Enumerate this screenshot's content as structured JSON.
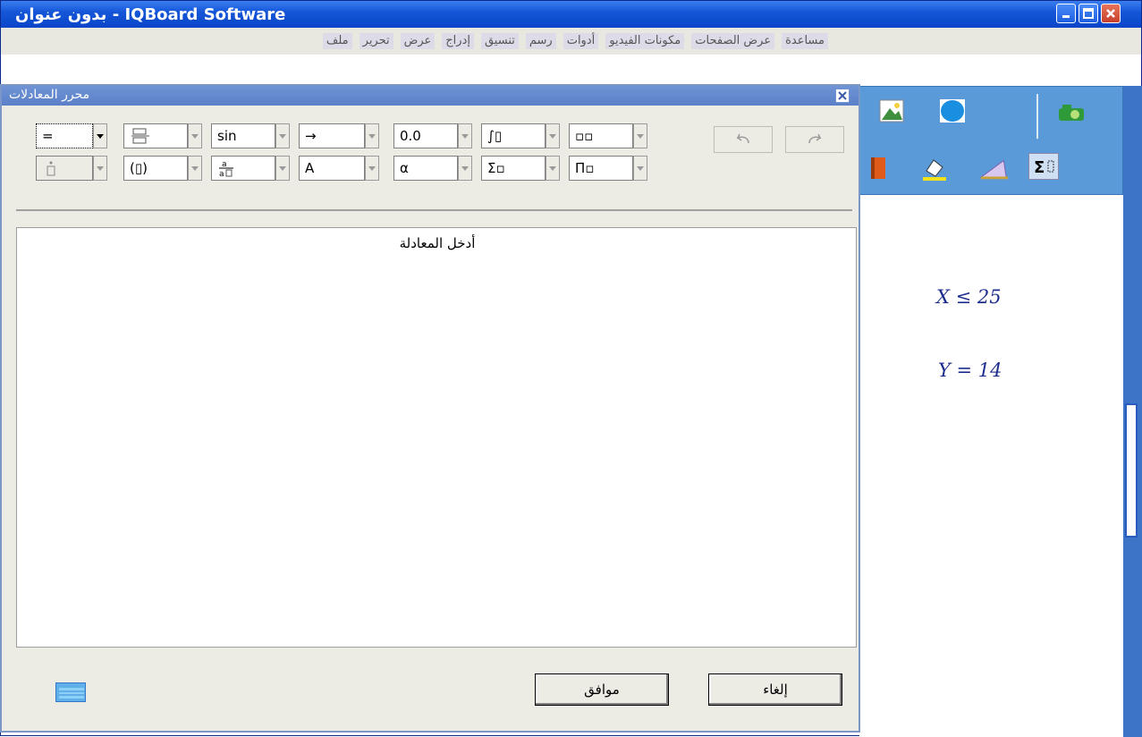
{
  "window": {
    "title": "بدون عنوان - IQBoard Software"
  },
  "menu": {
    "items": [
      "مساعدة",
      "عرض الصفحات",
      "مكونات الفيديو",
      "أدوات",
      "رسم",
      "تنسيق",
      "إدراج",
      "عرض",
      "تحرير",
      "ملف"
    ]
  },
  "dialog": {
    "title": "محرر المعادلات",
    "editor_placeholder": "أدخل المعادلة",
    "ok_label": "موافق",
    "cancel_label": "إلغاء",
    "toolbar_row1": [
      "=",
      "",
      "sin",
      "→",
      "0.0",
      "∫▯",
      "▫▫"
    ],
    "toolbar_row2": [
      "",
      "(▯)",
      "",
      "A",
      "α",
      "Σ̄▫",
      "Π̄▫"
    ]
  },
  "canvas": {
    "equations": [
      "X ≤ 25",
      "Y = 14"
    ]
  },
  "colors": {
    "title_bar": "#1557d8",
    "toolbar_panel": "#5b9ad8",
    "equation_text": "#1e2e8e",
    "dialog_bg": "#ecebe4"
  },
  "icons": [
    "minimize-icon",
    "maximize-icon",
    "close-icon",
    "picture-icon",
    "ellipse-icon",
    "camera-icon",
    "book-icon",
    "paint-bucket-icon",
    "protractor-icon",
    "sigma-icon",
    "undo-icon",
    "redo-icon",
    "keyboard-icon"
  ]
}
